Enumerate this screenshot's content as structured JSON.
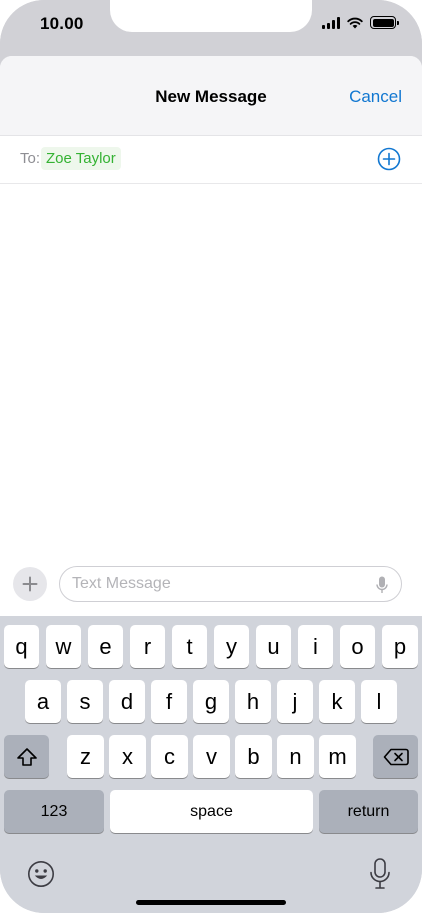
{
  "status_bar": {
    "time": "10.00",
    "battery_level": 1.0,
    "signal_bars": 4
  },
  "header": {
    "title": "New Message",
    "cancel_label": "Cancel"
  },
  "to_row": {
    "label": "To:",
    "recipient": "Zoe Taylor"
  },
  "compose": {
    "placeholder": "Text Message"
  },
  "keyboard": {
    "row1": [
      "q",
      "w",
      "e",
      "r",
      "t",
      "y",
      "u",
      "i",
      "o",
      "p"
    ],
    "row2": [
      "a",
      "s",
      "d",
      "f",
      "g",
      "h",
      "j",
      "k",
      "l"
    ],
    "row3": [
      "z",
      "x",
      "c",
      "v",
      "b",
      "n",
      "m"
    ],
    "numbers_label": "123",
    "space_label": "space",
    "return_label": "return"
  },
  "icons": {
    "shift": "shift-icon",
    "delete": "backspace-icon",
    "emoji": "emoji-icon",
    "dictation": "microphone-icon",
    "add": "plus-icon",
    "add_contact": "plus-circle-icon"
  },
  "colors": {
    "accent": "#1177d1",
    "recipient": "#34b233",
    "keyboard_bg": "#d1d4db",
    "key_func": "#abb0ba"
  }
}
